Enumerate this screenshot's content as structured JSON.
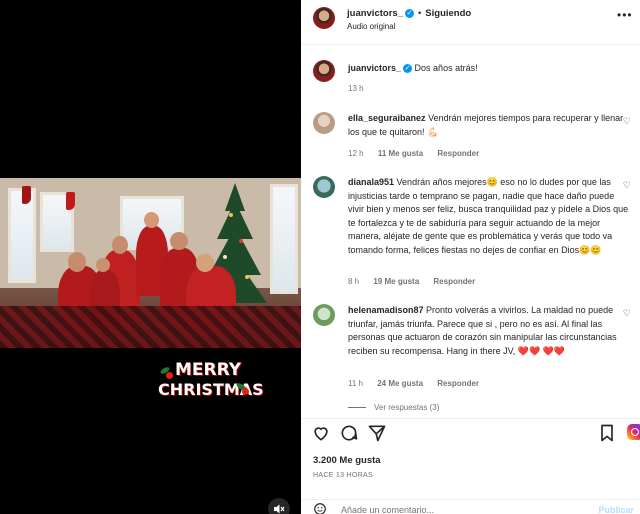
{
  "media": {
    "overlay_line1": "MERRY",
    "overlay_line2": "CHRISTMAS",
    "mute_icon": "speaker-muted-icon"
  },
  "header": {
    "username": "juanvictors_",
    "follow_state": "Siguiendo",
    "separator": "•",
    "audio": "Audio original",
    "more_icon": "ellipsis-icon"
  },
  "caption": {
    "username": "juanvictors_",
    "text": "Dos años atrás!",
    "time": "13 h"
  },
  "comments": [
    {
      "username": "ella_seguraibanez",
      "text": "Vendrán mejores tiempos para recuperar y llenar los que te quitaron! 💪🏻",
      "time": "12 h",
      "likes": "11 Me gusta",
      "reply": "Responder"
    },
    {
      "username": "dianala951",
      "text": "Vendrán años mejores😊 eso no lo dudes por que las injusticias tarde o temprano se pagan, nadie que hace daño puede vivir bien y menos ser feliz, busca tranquilidad paz y pídele a Dios que te fortalezca y te de sabiduría para seguir actuando de la mejor manera, aléjate de gente que es problemática y verás que todo va tomando forma, felices fiestas no dejes de confiar en Dios😊😊",
      "time": "8 h",
      "likes": "19 Me gusta",
      "reply": "Responder"
    },
    {
      "username": "helenamadison87",
      "text": "Pronto volverás a vivirlos. La maldad no puede triunfar, jamás triunfa. Parece que si , pero no es así. Al final las personas que actuaron de corazón sin manipular las circunstancias reciben su recompensa. Hang in there JV, ❤️❤️ ❤️❤️",
      "time": "11 h",
      "likes": "24 Me gusta",
      "reply": "Responder"
    }
  ],
  "replies_link": "Ver respuestas (3)",
  "actions": {
    "likes": "3.200 Me gusta",
    "ago": "HACE 13 HORAS",
    "comment_placeholder": "Añade un comentario...",
    "publish": "Publicar"
  },
  "colors": {
    "verified": "#0095f6",
    "meta_gray": "#737373",
    "text": "#262626",
    "heart_red": "#e0132f"
  }
}
